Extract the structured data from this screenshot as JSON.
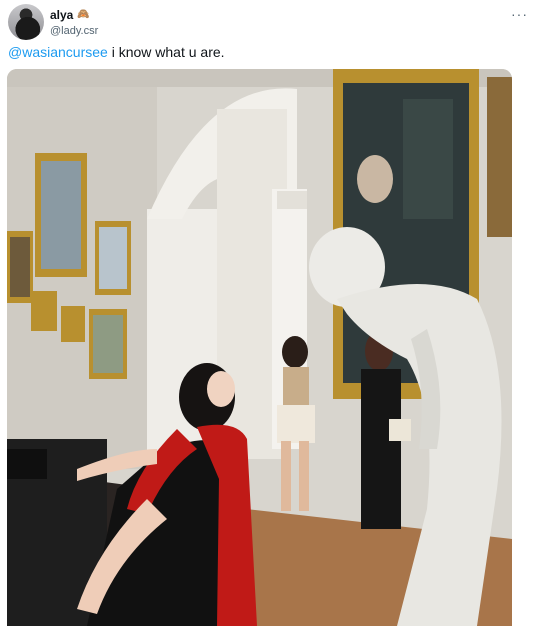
{
  "author": {
    "display_name": "alya",
    "badge_emoji": "🙈",
    "handle": "@lady.csr",
    "avatar_icon": "avatar-image"
  },
  "menu": {
    "more_label": "···"
  },
  "tweet": {
    "mention": "@wasiancursee",
    "body": " i know what u are."
  },
  "media": {
    "description_icon": "museum-photo",
    "colors": {
      "wall": "#d6d3cb",
      "floor": "#a8754a",
      "gold_frame": "#b8902f",
      "statue": "#ecebe7",
      "dress": "#111111",
      "scarf": "#c01a17"
    }
  }
}
